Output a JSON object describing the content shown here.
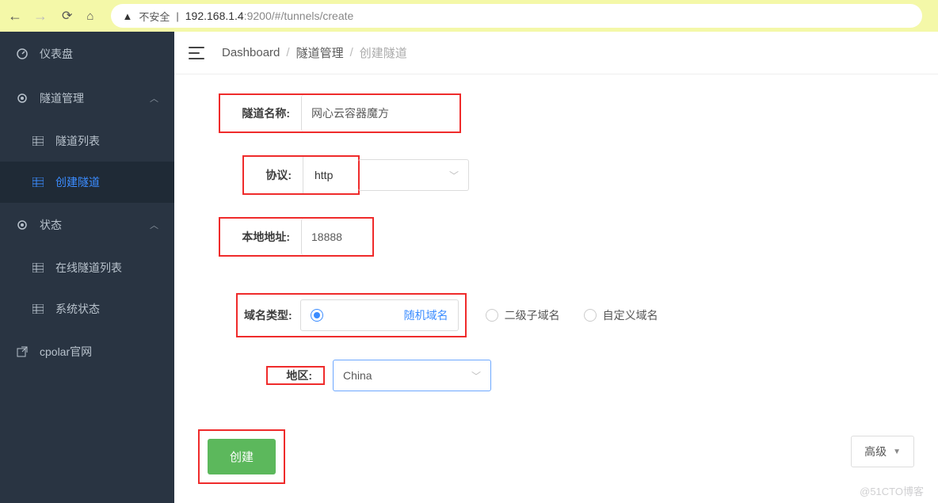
{
  "browser": {
    "insecure_label": "不安全",
    "host": "192.168.1.4",
    "port": ":9200",
    "path": "/#/tunnels/create"
  },
  "sidebar": {
    "dashboard": "仪表盘",
    "tunnel_mgmt": "隧道管理",
    "subs": {
      "list": "隧道列表",
      "create": "创建隧道"
    },
    "status": "状态",
    "status_subs": {
      "online": "在线隧道列表",
      "system": "系统状态"
    },
    "cpolar": "cpolar官网"
  },
  "breadcrumb": {
    "dashboard": "Dashboard",
    "tunnel_mgmt": "隧道管理",
    "current": "创建隧道"
  },
  "form": {
    "name_label": "隧道名称:",
    "name_value": "网心云容器魔方",
    "proto_label": "协议:",
    "proto_value": "http",
    "local_label": "本地地址:",
    "local_value": "18888",
    "domain_type_label": "域名类型:",
    "domain_random": "随机域名",
    "domain_secondary": "二级子域名",
    "domain_custom": "自定义域名",
    "region_label": "地区:",
    "region_value": "China",
    "advanced": "高级",
    "create": "创建"
  },
  "watermark": "@51CTO博客"
}
